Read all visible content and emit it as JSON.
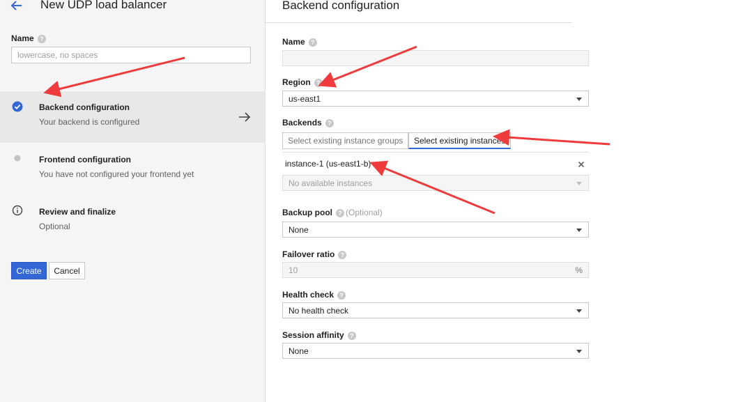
{
  "left_panel": {
    "title": "New UDP load balancer",
    "name_label": "Name",
    "name_placeholder": "lowercase, no spaces",
    "steps": [
      {
        "title": "Backend configuration",
        "subtitle": "Your backend is configured",
        "status": "complete",
        "active": true
      },
      {
        "title": "Frontend configuration",
        "subtitle": "You have not configured your frontend yet",
        "status": "pending",
        "active": false
      },
      {
        "title": "Review and finalize",
        "subtitle": "Optional",
        "status": "info",
        "active": false
      }
    ],
    "create_label": "Create",
    "cancel_label": "Cancel"
  },
  "right_panel": {
    "title": "Backend configuration",
    "name_label": "Name",
    "region_label": "Region",
    "region_value": "us-east1",
    "backends_label": "Backends",
    "backend_tabs": [
      "Select existing instance groups",
      "Select existing instances"
    ],
    "selected_tab_index": 1,
    "instance_chip": "instance-1 (us-east1-b)",
    "instances_placeholder": "No available instances",
    "backup_pool_label": "Backup pool",
    "backup_pool_optional": "(Optional)",
    "backup_pool_value": "None",
    "failover_ratio_label": "Failover ratio",
    "failover_ratio_value": "10",
    "failover_ratio_unit": "%",
    "health_check_label": "Health check",
    "health_check_value": "No health check",
    "session_affinity_label": "Session affinity",
    "session_affinity_value": "None"
  },
  "colors": {
    "accent": "#3367d6",
    "annotation": "#ef3b3b",
    "left_background": "#f5f5f5",
    "active_step": "#e8e8e8"
  },
  "icons": [
    "back-arrow-icon",
    "help-icon",
    "check-circle-icon",
    "dot-icon",
    "info-icon",
    "arrow-right-icon",
    "dropdown-caret-icon",
    "close-icon"
  ]
}
